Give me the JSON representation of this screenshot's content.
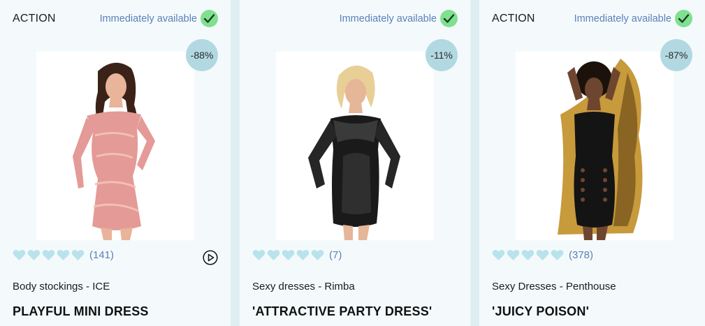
{
  "products": [
    {
      "badge": "ACTION",
      "availability": "Immediately available",
      "discount": "-88%",
      "rating_count": "(141)",
      "category": "Body stockings - ICE",
      "name": "PLAYFUL MINI DRESS",
      "has_video": true,
      "image_desc": "model wearing pink lace mini dress"
    },
    {
      "badge": "",
      "availability": "Immediately available",
      "discount": "-11%",
      "rating_count": "(7)",
      "category": "Sexy dresses - Rimba",
      "name": "'ATTRACTIVE PARTY DRESS'",
      "has_video": false,
      "image_desc": "model wearing black wetlook dress with lace sleeves"
    },
    {
      "badge": "ACTION",
      "availability": "Immediately available",
      "discount": "-87%",
      "rating_count": "(378)",
      "category": "Sexy Dresses - Penthouse",
      "name": "'JUICY POISON'",
      "has_video": false,
      "image_desc": "model wearing black cut-out mesh dress"
    }
  ],
  "colors": {
    "page_bg": "#dfeef3",
    "card_bg": "#f4fafc",
    "accent_blue": "#5a80b8",
    "discount_bg": "#b2d9e2",
    "check_bg": "#7fe08f",
    "heart": "#b9e3ec"
  },
  "icons": {
    "availability": "check-circle-icon",
    "rating": "heart-icon",
    "video": "play-circle-icon"
  }
}
